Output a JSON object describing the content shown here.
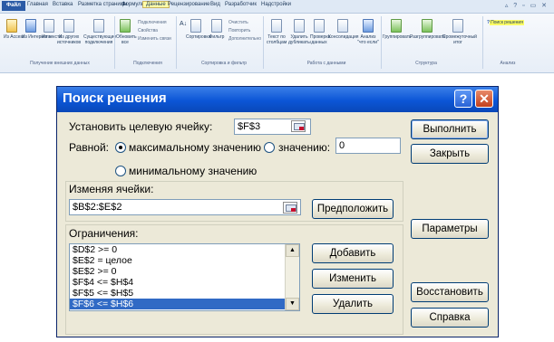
{
  "ribbon": {
    "tabs": [
      "Файл",
      "Главная",
      "Вставка",
      "Разметка страницы",
      "Формулы",
      "Данные",
      "Рецензирование",
      "Вид",
      "Разработчик",
      "Надстройки"
    ],
    "external": {
      "access": "Из Access",
      "web": "Из Интернета",
      "text": "Из текста",
      "other": "Из других источников",
      "existing": "Существующие подключения",
      "group": "Получение внешних данных"
    },
    "connections": {
      "refresh": "Обновить все",
      "conn": "Подключения",
      "props": "Свойства",
      "links": "Изменить связи",
      "group": "Подключения"
    },
    "sort": {
      "sort": "Сортировка",
      "filter": "Фильтр",
      "clear": "Очистить",
      "reapply": "Повторить",
      "advanced": "Дополнительно",
      "group": "Сортировка и фильтр"
    },
    "tools": {
      "text_to_cols": "Текст по столбцам",
      "remove_dup": "Удалить дубликаты",
      "validate": "Проверка данных",
      "consolidate": "Консолидация",
      "whatif": "Анализ \"что если\"",
      "group": "Работа с данными"
    },
    "outline": {
      "group_btn": "Группировать",
      "ungroup": "Разгруппировать",
      "subtotal": "Промежуточный итог",
      "group": "Структура"
    },
    "analysis": {
      "solver": "Поиск решения",
      "group": "Анализ"
    }
  },
  "dialog": {
    "title": "Поиск решения",
    "target_label": "Установить целевую ячейку:",
    "target_value": "$F$3",
    "equal_label": "Равной:",
    "opt_max": "максимальному значению",
    "opt_value": "значению:",
    "value_field": "0",
    "opt_min": "минимальному значению",
    "changing_label": "Изменяя ячейки:",
    "changing_value": "$B$2:$E$2",
    "guess_button": "Предположить",
    "constraints_label": "Ограничения:",
    "constraints": [
      "$D$2 >= 0",
      "$E$2 = целое",
      "$E$2 >= 0",
      "$F$4 <= $H$4",
      "$F$5 <= $H$5",
      "$F$6 <= $H$6"
    ],
    "selected_index": 5,
    "buttons": {
      "solve": "Выполнить",
      "close": "Закрыть",
      "options": "Параметры",
      "add": "Добавить",
      "change": "Изменить",
      "delete": "Удалить",
      "reset": "Восстановить",
      "help": "Справка"
    }
  }
}
